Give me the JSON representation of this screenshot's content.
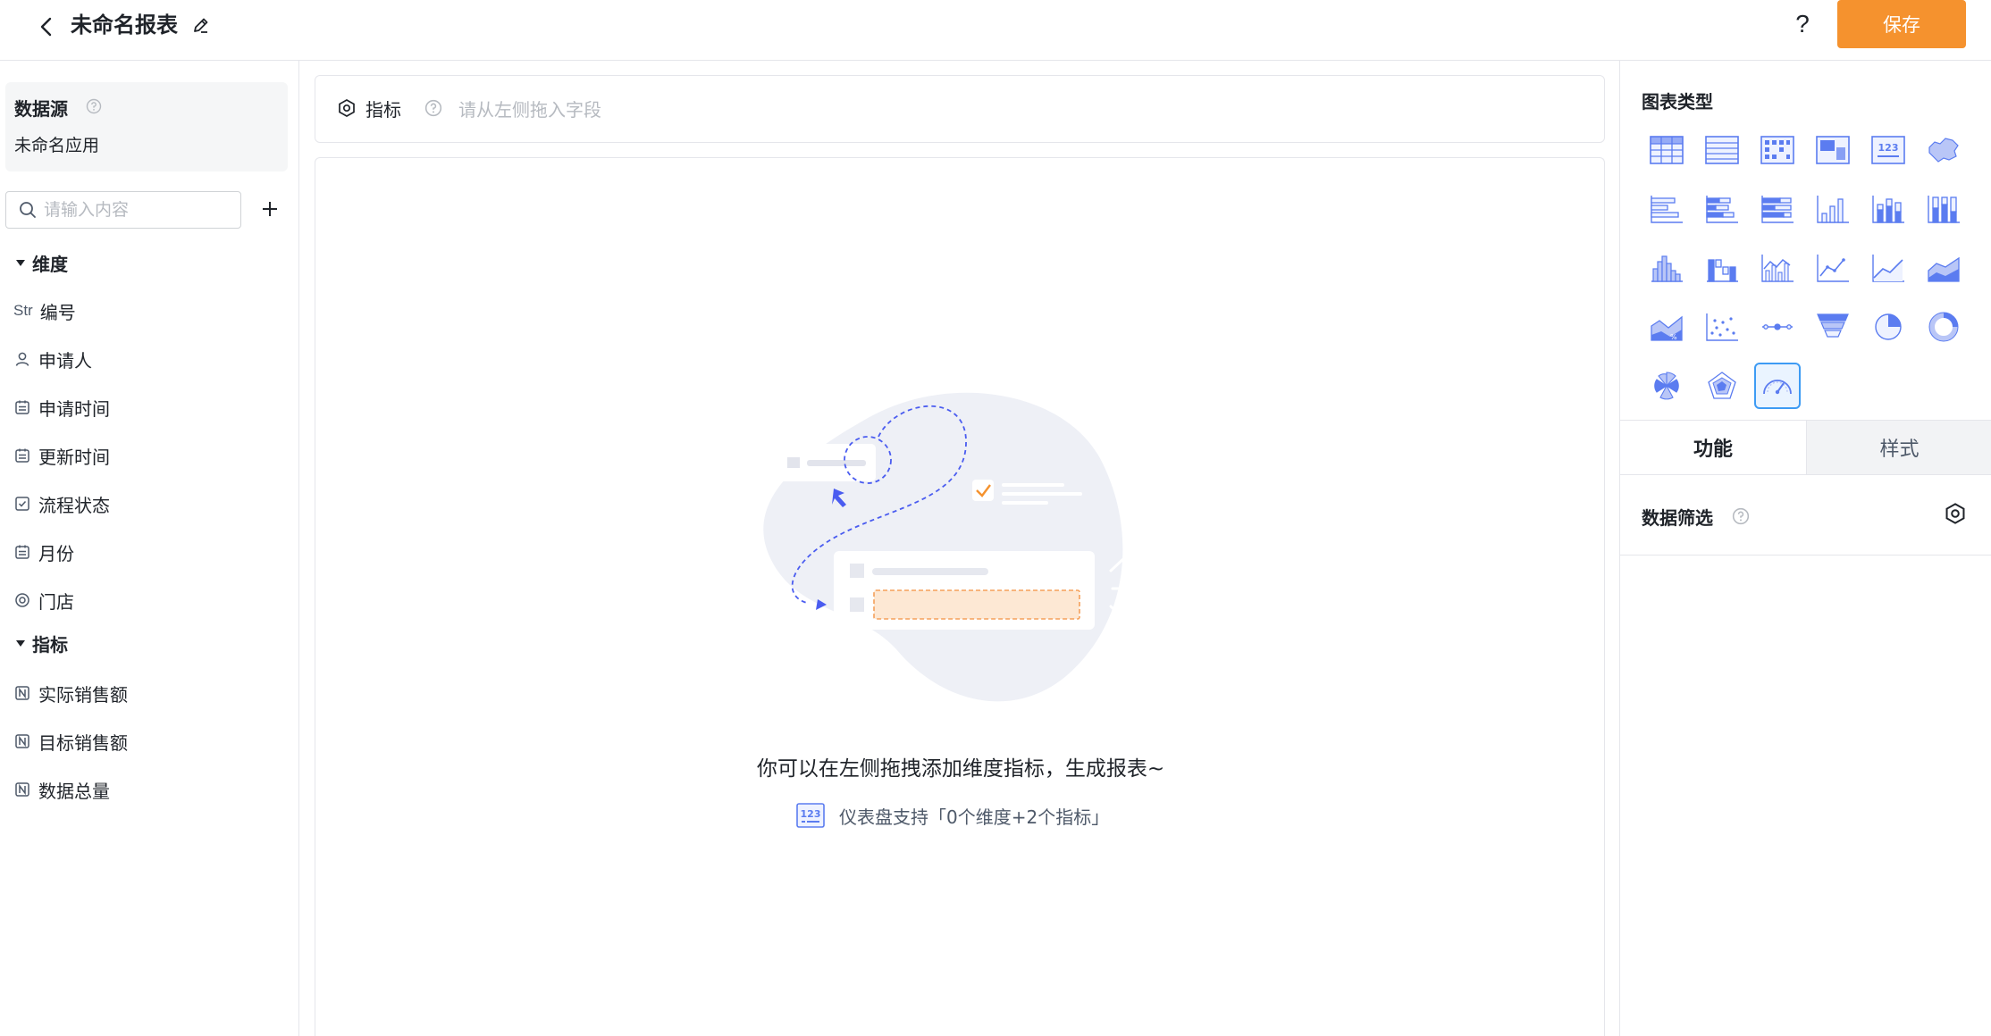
{
  "header": {
    "title": "未命名报表",
    "help": "?",
    "save_label": "保存"
  },
  "left": {
    "datasource_title": "数据源",
    "datasource_app": "未命名应用",
    "search_placeholder": "请输入内容",
    "dimensions_title": "维度",
    "dimensions": [
      {
        "label": "编号",
        "icon": "str-tag",
        "tag": "Str"
      },
      {
        "label": "申请人",
        "icon": "user-icon"
      },
      {
        "label": "申请时间",
        "icon": "calendar-icon"
      },
      {
        "label": "更新时间",
        "icon": "calendar-icon"
      },
      {
        "label": "流程状态",
        "icon": "checkbox-icon"
      },
      {
        "label": "月份",
        "icon": "calendar-icon"
      },
      {
        "label": "门店",
        "icon": "radio-icon"
      }
    ],
    "metrics_title": "指标",
    "metrics": [
      {
        "label": "实际销售额",
        "icon": "number-icon"
      },
      {
        "label": "目标销售额",
        "icon": "number-icon"
      },
      {
        "label": "数据总量",
        "icon": "number-icon"
      }
    ]
  },
  "metric_bar": {
    "label": "指标",
    "placeholder": "请从左侧拖入字段"
  },
  "canvas": {
    "empty_text": "你可以在左侧拖拽添加维度指标，生成报表~",
    "hint_text": "仪表盘支持「0个维度+2个指标」",
    "glyph_text": "123"
  },
  "right": {
    "chart_type_title": "图表类型",
    "chart_types": [
      "table-icon",
      "detail-table-icon",
      "pivot-table-icon",
      "cross-table-icon",
      "number-card-icon",
      "map-icon",
      "bar-icon",
      "stacked-bar-icon",
      "percent-bar-icon",
      "column-icon",
      "stacked-column-icon",
      "percent-column-icon",
      "histogram-icon",
      "waterfall-icon",
      "combo-icon",
      "line-icon",
      "area-line-icon",
      "stacked-area-icon",
      "percent-area-icon",
      "scatter-icon",
      "timeline-icon",
      "funnel-icon",
      "pie-icon",
      "donut-icon",
      "rose-icon",
      "radar-icon",
      "gauge-icon"
    ],
    "active_chart": "gauge-icon",
    "tabs": [
      "功能",
      "样式"
    ],
    "filter_label": "数据筛选",
    "colors": {
      "accent": "#f5922e",
      "selected": "#3d9bf4",
      "chart_blue": "#5b7cf0"
    }
  }
}
